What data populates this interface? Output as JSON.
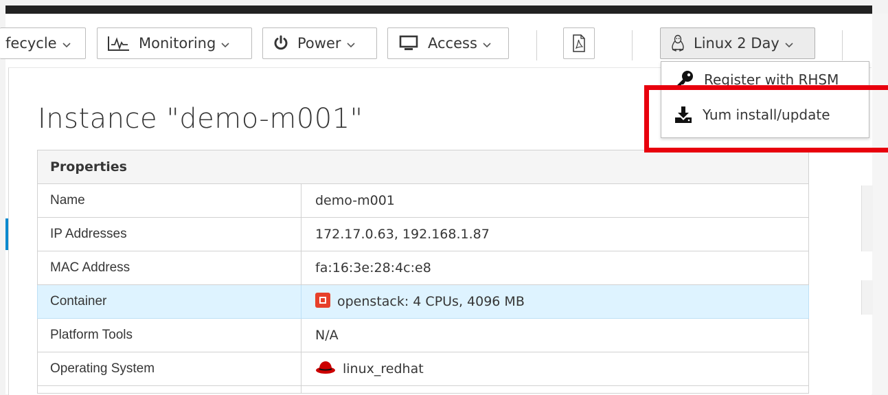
{
  "toolbar": {
    "lifecycle": "fecycle",
    "monitoring": "Monitoring",
    "power": "Power",
    "access": "Access",
    "linux_menu": "Linux 2 Day"
  },
  "icons": {
    "monitoring": "pulse-chart-icon",
    "power": "power-icon",
    "access": "monitor-icon",
    "pdf": "pdf-icon",
    "linux": "linux-penguin-icon",
    "rhsm": "key-icon",
    "yum": "download-icon"
  },
  "dropdown": {
    "items": [
      {
        "label": "Register with RHSM"
      },
      {
        "label": "Yum install/update"
      }
    ]
  },
  "page": {
    "title": "Instance \"demo-m001\""
  },
  "properties": {
    "header": "Properties",
    "rows": [
      {
        "key": "Name",
        "value": "demo-m001"
      },
      {
        "key": "IP Addresses",
        "value": "172.17.0.63, 192.168.1.87"
      },
      {
        "key": "MAC Address",
        "value": "fa:16:3e:28:4c:e8"
      },
      {
        "key": "Container",
        "value": "openstack: 4 CPUs, 4096 MB"
      },
      {
        "key": "Platform Tools",
        "value": "N/A"
      },
      {
        "key": "Operating System",
        "value": "linux_redhat"
      }
    ]
  },
  "colors": {
    "highlight": "#e8000d",
    "selected_row": "#def3ff",
    "accent": "#0088ce"
  }
}
